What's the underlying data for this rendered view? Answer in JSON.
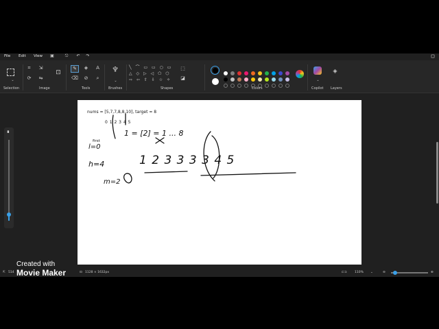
{
  "menu": {
    "file": "File",
    "edit": "Edit",
    "view": "View"
  },
  "groups": {
    "selection": "Selection",
    "image": "Image",
    "tools": "Tools",
    "brushes": "Brushes",
    "shapes": "Shapes",
    "colors": "Colors",
    "copilot": "Copilot",
    "layers": "Layers"
  },
  "palette": [
    "#ffffff",
    "#7f7f7f",
    "#e03030",
    "#e81870",
    "#f06a20",
    "#f7c51e",
    "#22b14c",
    "#00a2e8",
    "#3f48cc",
    "#a349a4",
    "#000000",
    "#c3c3c3",
    "#b97a57",
    "#ffaec9",
    "#ffc90e",
    "#efe4b0",
    "#b5e61d",
    "#99d9ea",
    "#7092be",
    "#c8bfe7"
  ],
  "selected_colors": {
    "primary": "#000000",
    "secondary": "#ffffff"
  },
  "canvas_text": {
    "nums_line": "nums = [5,7,7,8,8,10],    target = 8",
    "index_line": "0  1  2  3  4  5",
    "first_label": "first",
    "l_line": "l=0",
    "h_line": "h=4",
    "mid_line": "m=2",
    "sequence": "1 2   3 3  3 3  4 5",
    "top_note": "1 = [2] = 1 ... 8"
  },
  "status": {
    "dimensions": "1128 × 1632px",
    "zoom": "110%",
    "position": "514"
  },
  "zoom_slider": {
    "level": 0.12
  },
  "size_slider": {
    "level": 0.08
  },
  "watermark": {
    "line1": "Created with",
    "line2": "Movie Maker"
  },
  "accent": "#3aa0e8"
}
